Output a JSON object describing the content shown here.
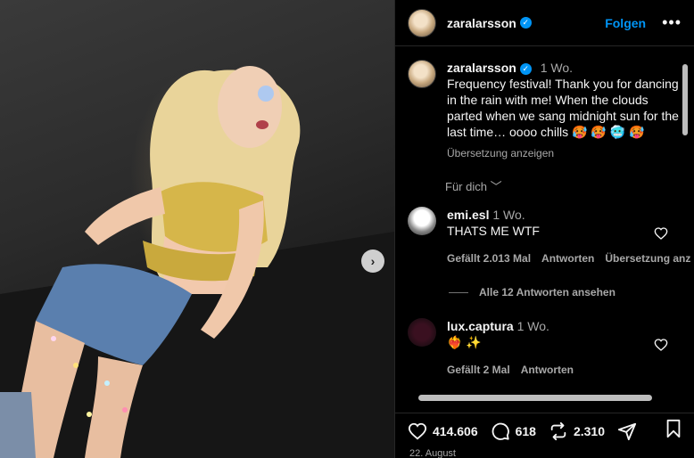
{
  "header": {
    "username": "zaralarsson",
    "follow_label": "Folgen",
    "more_label": "•••"
  },
  "caption": {
    "username": "zaralarsson",
    "time": "1 Wo.",
    "text": "Frequency festival! Thank you for dancing in the rain with me! When the clouds parted when we sang midnight sun for the last time… oooo chills 🥵 🥵 🥶 🥵",
    "translate_label": "Übersetzung anzeigen"
  },
  "sort_label": "Für dich ﹀",
  "comments": [
    {
      "username": "emi.esl",
      "time": "1 Wo.",
      "text": "THATS ME WTF",
      "likes": "Gefällt 2.013 Mal",
      "reply_label": "Antworten",
      "translate_label": "Übersetzung anz",
      "view_replies": "Alle 12 Antworten ansehen"
    },
    {
      "username": "lux.captura",
      "time": "1 Wo.",
      "text": "❤️‍🔥 ✨",
      "likes": "Gefällt 2 Mal",
      "reply_label": "Antworten"
    }
  ],
  "actions": {
    "likes": "414.606",
    "comments": "618",
    "reposts": "2.310"
  },
  "date": "22. August",
  "colors": {
    "accent": "#0095f6",
    "background": "#000000",
    "muted": "#a8a8a8"
  },
  "icons": [
    "chevron-right-icon",
    "verified-icon",
    "more-icon",
    "heart-icon",
    "comment-icon",
    "repost-icon",
    "share-icon",
    "bookmark-icon"
  ]
}
